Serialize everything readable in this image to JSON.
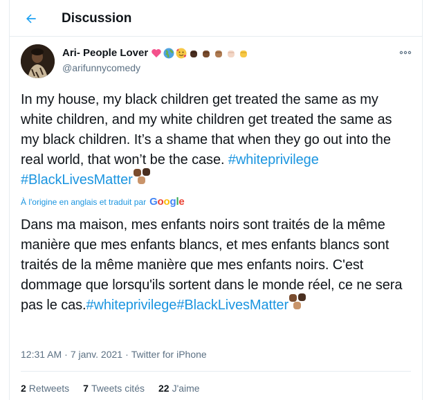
{
  "header": {
    "title": "Discussion",
    "back_icon": "arrow-left-icon",
    "accent": "#1da1f2"
  },
  "author": {
    "display_name": "Ari- People Lover",
    "handle": "@arifunnycomedy",
    "name_emojis": [
      "sparkling-heart",
      "earth-globe",
      "smiling-face-with-hearts",
      "raised-fist-dark",
      "raised-fist-medium-dark",
      "raised-fist-medium",
      "raised-fist-light",
      "raised-fist-yellow"
    ]
  },
  "tweet": {
    "original_text": "In my house, my black children get treated the same as my white children, and my white children get treated the same as my black children. It’s a shame that when they go out into the real world, that won’t be the case.",
    "hashtag1": "#whiteprivilege",
    "hashtag2": "#BlackLivesMatter",
    "translated_by": "À l'origine en anglais et traduit par",
    "translation_provider": "Google",
    "translated_text": "Dans ma maison, mes enfants noirs sont traités de la même manière que mes enfants blancs, et mes enfants blancs sont traités de la même manière que mes enfants noirs. C'est dommage que lorsqu'ils sortent dans le monde réel, ce ne sera pas le cas.",
    "time": "12:31 AM",
    "date": "7 janv. 2021",
    "source": "Twitter for iPhone",
    "separator": "·"
  },
  "stats": {
    "retweets_count": "2",
    "retweets_label": "Retweets",
    "quotes_count": "7",
    "quotes_label": "Tweets cités",
    "likes_count": "22",
    "likes_label": "J'aime"
  },
  "colors": {
    "link": "#1b95e0",
    "secondary_text": "#5b7083",
    "border": "#e6ecf0"
  }
}
